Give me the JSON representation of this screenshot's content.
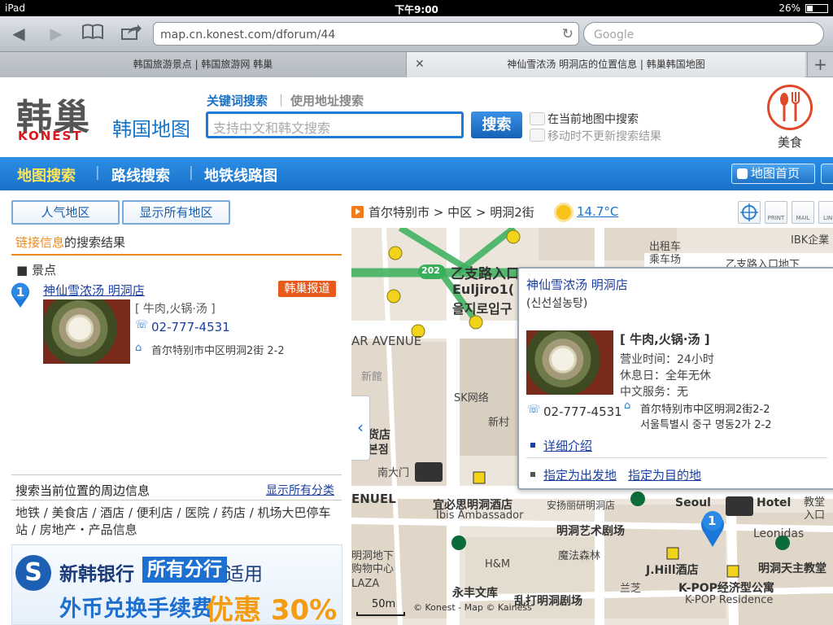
{
  "status": {
    "device": "iPad",
    "time": "下午9:00",
    "battery": "26%"
  },
  "browser": {
    "url": "map.cn.konest.com/dforum/44",
    "search_placeholder": "Google",
    "tabs": [
      {
        "title": "韩国旅游景点 | 韩国旅游网 韩巢"
      },
      {
        "title": "神仙雪浓汤 明洞店的位置信息 | 韩巢韩国地图"
      }
    ]
  },
  "header": {
    "logo_cn": "韩巢",
    "logo_en": "KONEST",
    "site_title": "韩国地图",
    "search_tabs": [
      "关键词搜索",
      "使用地址搜索"
    ],
    "search_placeholder": "支持中文和韩文搜索",
    "search_button": "搜索",
    "checkbox1": "在当前地图中搜索",
    "checkbox2": "移动时不更新搜索结果",
    "food_label": "美食"
  },
  "nav": {
    "items": [
      "地图搜索",
      "路线搜索",
      "地铁线路图"
    ],
    "map_home": "地图首页"
  },
  "left": {
    "btn_popular": "人气地区",
    "btn_all": "显示所有地区",
    "result_prefix": "链接信息",
    "result_suffix": "的搜索结果",
    "category": "景点",
    "result": {
      "num": "1",
      "name": "神仙雪浓汤 明洞店",
      "badge": "韩巢报道",
      "cat": "[ 牛肉,火锅·汤 ]",
      "phone": "02-777-4531",
      "address": "首尔特别市中区明洞2街 2-2"
    },
    "nearby_title": "搜索当前位置的周边信息",
    "show_all_cats": "显示所有分类",
    "nearby_cats": "地铁 / 美食店 / 酒店 / 便利店 / 医院 / 药店 / 机场大巴停车站 / 房地产・产品信息"
  },
  "ad": {
    "bank": "新韩银行",
    "highlight": "所有分行",
    "suffix": "适用",
    "line2": "外币兑换手续费",
    "promo": "优惠 30%"
  },
  "map_header": {
    "breadcrumb": "首尔特别市 > 中区 > 明洞2街",
    "temp": "14.7°C",
    "tools": [
      "",
      "PRINT",
      "MAIL",
      "LINK"
    ]
  },
  "map": {
    "labels": [
      {
        "t": "乙支路入口",
        "cls": "b"
      },
      {
        "t": "Euljiro1(",
        "cls": "b"
      },
      {
        "t": "을지로입구",
        "cls": "b"
      },
      {
        "t": "出租车",
        "cls": "n"
      },
      {
        "t": "乘车场",
        "cls": "n"
      },
      {
        "t": "IBK企業",
        "cls": "n"
      },
      {
        "t": "乙支路入口地下",
        "cls": "n"
      },
      {
        "t": "AR AVENUE",
        "cls": "n"
      },
      {
        "t": "新館",
        "cls": "g"
      },
      {
        "t": "SK网络",
        "cls": "n"
      },
      {
        "t": "新村",
        "cls": "n"
      },
      {
        "t": "货店",
        "cls": "b"
      },
      {
        "t": "본점",
        "cls": "b"
      },
      {
        "t": "南大门",
        "cls": "n"
      },
      {
        "t": "ENUEL",
        "cls": "b"
      },
      {
        "t": "宜必思明洞酒店",
        "cls": "b"
      },
      {
        "t": "Ibis Ambassador",
        "cls": "n"
      },
      {
        "t": "安扬丽研明洞店",
        "cls": "n"
      },
      {
        "t": "Seoul",
        "cls": "b"
      },
      {
        "t": "Hotel",
        "cls": "b"
      },
      {
        "t": "教堂",
        "cls": "n"
      },
      {
        "t": "入口",
        "cls": "n"
      },
      {
        "t": "明洞艺术剧场",
        "cls": "b"
      },
      {
        "t": "Leonidas",
        "cls": "n"
      },
      {
        "t": "魔法森林",
        "cls": "n"
      },
      {
        "t": "J.Hill酒店",
        "cls": "b"
      },
      {
        "t": "明洞天主教堂",
        "cls": "b"
      },
      {
        "t": "明洞地下",
        "cls": "n"
      },
      {
        "t": "购物中心",
        "cls": "n"
      },
      {
        "t": "H&M",
        "cls": "n"
      },
      {
        "t": "LAZA",
        "cls": "n"
      },
      {
        "t": "永丰文库",
        "cls": "b"
      },
      {
        "t": "乱打明洞剧场",
        "cls": "b"
      },
      {
        "t": "兰芝",
        "cls": "n"
      },
      {
        "t": "K-POP经济型公寓",
        "cls": "b"
      },
      {
        "t": "K-POP Residence",
        "cls": "n"
      },
      {
        "t": "202",
        "cls": "w"
      },
      {
        "t": "1",
        "cls": "n"
      }
    ]
  },
  "popup": {
    "name": "神仙雪浓汤 明洞店",
    "korean": "(신선설농탕)",
    "category": "[ 牛肉,火锅·汤 ]",
    "hours": "营业时间：24小时",
    "closed": "休息日：全年无休",
    "chinese": "中文服务：无",
    "phone": "02-777-4531",
    "addr_cn": "首尔特别市中区明洞2街2-2",
    "addr_kr": "서울특별시 중구 명동2가 2-2",
    "detail": "详细介绍",
    "set_start": "指定为出发地",
    "set_dest": "指定为目的地"
  },
  "scale": {
    "label": "50m",
    "copyright": "© Konest - Map © Kainess"
  }
}
